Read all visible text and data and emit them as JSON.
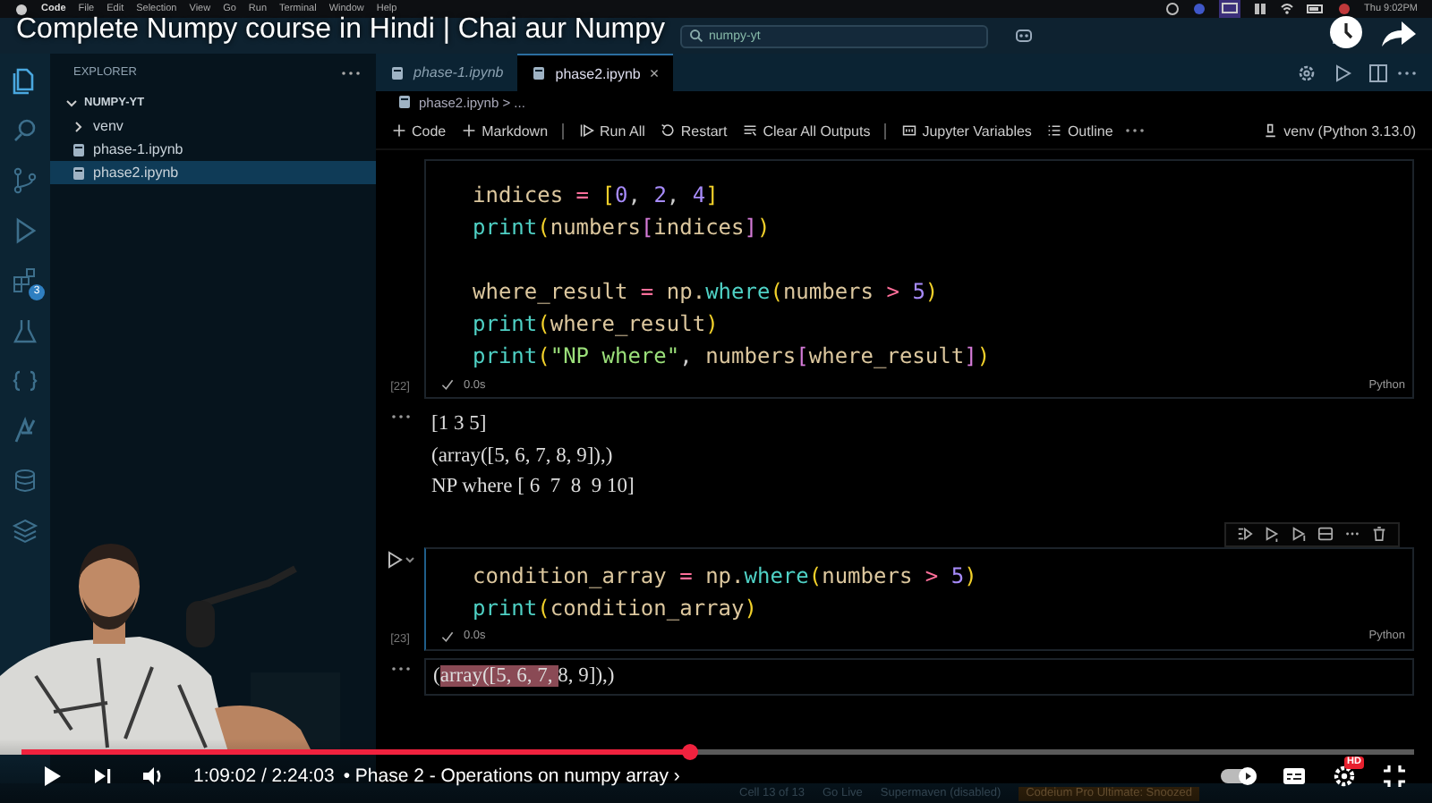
{
  "menu_bar": {
    "items": [
      "Code",
      "File",
      "Edit",
      "Selection",
      "View",
      "Go",
      "Run",
      "Terminal",
      "Window",
      "Help"
    ],
    "clock": "Thu 9:02PM"
  },
  "video_title": "Complete Numpy course in Hindi | Chai aur Numpy",
  "search": {
    "value": "numpy-yt"
  },
  "activity_bar": {
    "badge": "3"
  },
  "explorer": {
    "title": "EXPLORER",
    "folder": "NUMPY-YT",
    "items": [
      {
        "name": "venv",
        "kind": "folder",
        "selected": false
      },
      {
        "name": "phase-1.ipynb",
        "kind": "file",
        "selected": false
      },
      {
        "name": "phase2.ipynb",
        "kind": "file",
        "selected": true
      }
    ]
  },
  "tabs": [
    {
      "label": "phase-1.ipynb",
      "selected": false,
      "preview": true
    },
    {
      "label": "phase2.ipynb",
      "selected": true,
      "preview": false,
      "close": "×"
    }
  ],
  "breadcrumb": "phase2.ipynb > ...",
  "toolbar": {
    "items": [
      {
        "label": "Code",
        "kind": "plus"
      },
      {
        "label": "Markdown",
        "kind": "plus",
        "divider_after": true
      },
      {
        "label": "Run All",
        "kind": "run"
      },
      {
        "label": "Restart",
        "kind": "restart"
      },
      {
        "label": "Clear All Outputs",
        "kind": "clear",
        "divider_after": true
      },
      {
        "label": "Jupyter Variables",
        "kind": "variables"
      },
      {
        "label": "Outline",
        "kind": "outline"
      }
    ],
    "kernel": "venv (Python 3.13.0)"
  },
  "cells": [
    {
      "count": "[22]",
      "time": "0.0s",
      "language": "Python",
      "focused": false,
      "lines": [
        {
          "tokens": [
            {
              "text": "indices",
              "kind": "name"
            },
            {
              "text": " = ",
              "kind": "op"
            },
            {
              "text": "[",
              "kind": "b1"
            },
            {
              "text": "0",
              "kind": "num"
            },
            {
              "text": ", ",
              "kind": "plain"
            },
            {
              "text": "2",
              "kind": "num"
            },
            {
              "text": ", ",
              "kind": "plain"
            },
            {
              "text": "4",
              "kind": "num"
            },
            {
              "text": "]",
              "kind": "b1"
            }
          ]
        },
        {
          "tokens": [
            {
              "text": "print",
              "kind": "fn"
            },
            {
              "text": "(",
              "kind": "b1"
            },
            {
              "text": "numbers",
              "kind": "name"
            },
            {
              "text": "[",
              "kind": "b2"
            },
            {
              "text": "indices",
              "kind": "name"
            },
            {
              "text": "]",
              "kind": "b2"
            },
            {
              "text": ")",
              "kind": "b1"
            }
          ]
        },
        {
          "gap_before": true,
          "tokens": [
            {
              "text": "where_result",
              "kind": "name"
            },
            {
              "text": " = ",
              "kind": "op"
            },
            {
              "text": "np.",
              "kind": "name"
            },
            {
              "text": "where",
              "kind": "fn"
            },
            {
              "text": "(",
              "kind": "b1"
            },
            {
              "text": "numbers ",
              "kind": "name"
            },
            {
              "text": ">",
              "kind": "op"
            },
            {
              "text": " 5",
              "kind": "num"
            },
            {
              "text": ")",
              "kind": "b1"
            }
          ]
        },
        {
          "tokens": [
            {
              "text": "print",
              "kind": "fn"
            },
            {
              "text": "(",
              "kind": "b1"
            },
            {
              "text": "where_result",
              "kind": "name"
            },
            {
              "text": ")",
              "kind": "b1"
            }
          ]
        },
        {
          "tokens": [
            {
              "text": "print",
              "kind": "fn"
            },
            {
              "text": "(",
              "kind": "b1"
            },
            {
              "text": "\"NP where\"",
              "kind": "str"
            },
            {
              "text": ", ",
              "kind": "plain"
            },
            {
              "text": "numbers",
              "kind": "name"
            },
            {
              "text": "[",
              "kind": "b2"
            },
            {
              "text": "where_result",
              "kind": "name"
            },
            {
              "text": "]",
              "kind": "b2"
            },
            {
              "text": ")",
              "kind": "b1"
            }
          ]
        }
      ],
      "outputs": [
        [
          {
            "text": "[1 3 5]",
            "selected": false
          }
        ],
        [
          {
            "text": "(array([5, 6, 7, 8, 9]),)",
            "selected": false
          }
        ],
        [
          {
            "text": "NP where [ 6  7  8  9 10]",
            "selected": false
          }
        ]
      ]
    },
    {
      "count": "[23]",
      "time": "0.0s",
      "language": "Python",
      "focused": true,
      "lines": [
        {
          "tokens": [
            {
              "text": "condition_array",
              "kind": "name"
            },
            {
              "text": " = ",
              "kind": "op"
            },
            {
              "text": "np.",
              "kind": "name"
            },
            {
              "text": "where",
              "kind": "fn"
            },
            {
              "text": "(",
              "kind": "b1"
            },
            {
              "text": "numbers ",
              "kind": "name"
            },
            {
              "text": ">",
              "kind": "op"
            },
            {
              "text": " 5",
              "kind": "num"
            },
            {
              "text": ")",
              "kind": "b1"
            }
          ]
        },
        {
          "tokens": [
            {
              "text": "print",
              "kind": "fn"
            },
            {
              "text": "(",
              "kind": "b1"
            },
            {
              "text": "condition_array",
              "kind": "name"
            },
            {
              "text": ")",
              "kind": "b1"
            }
          ]
        }
      ],
      "outputs": [
        [
          {
            "text": "(",
            "selected": false
          },
          {
            "text": "array([5, 6, 7, ",
            "selected": true
          },
          {
            "text": "8, 9]),)",
            "selected": false
          }
        ]
      ]
    }
  ],
  "status_bar": [
    {
      "text": "Cell 13 of 13",
      "kind": "plain"
    },
    {
      "text": "Go Live",
      "kind": "plain"
    },
    {
      "text": "Supermaven (disabled)",
      "kind": "plain"
    },
    {
      "text": "Codeium Pro Ultimate: Snoozed",
      "kind": "warning"
    }
  ],
  "player": {
    "time": "1:09:02 / 2:24:03",
    "chapter": "• Phase 2 - Operations on numpy array ›",
    "level": 0.48,
    "autoplay": true,
    "quality_badge": "HD"
  }
}
